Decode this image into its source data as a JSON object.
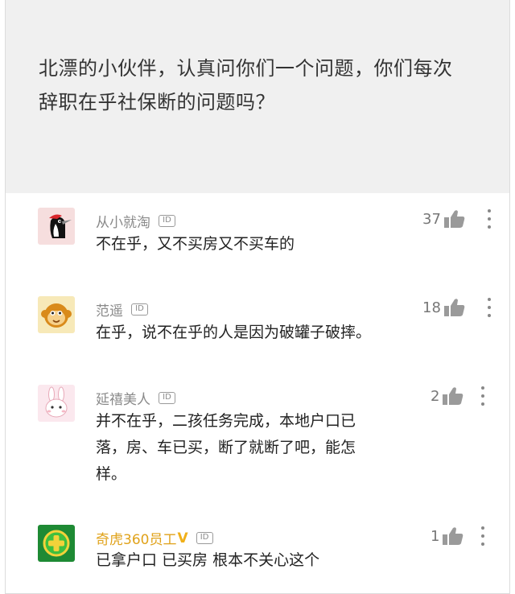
{
  "question": {
    "text_line1": "北漂的小伙伴，认真问你们一个问题，你们每次",
    "text_line2": "辞职在乎社保断的问题吗？"
  },
  "comments": [
    {
      "username": "从小就淘",
      "id_badge": "ID",
      "likes": "37",
      "avatar_icon": "woodpecker-avatar-icon",
      "lines": [
        "不在乎，又不买房又不买车的"
      ]
    },
    {
      "username": "范遥",
      "id_badge": "ID",
      "likes": "18",
      "avatar_icon": "monkey-avatar-icon",
      "lines": [
        "在乎，说不在乎的人是因为破罐子破摔。"
      ]
    },
    {
      "username": "延禧美人",
      "id_badge": "ID",
      "likes": "2",
      "avatar_icon": "rabbit-avatar-icon",
      "lines": [
        "并不在乎，二孩任务完成，本地户口已",
        "落，房、车已买，断了就断了吧，能怎",
        "样。"
      ]
    },
    {
      "username": "奇虎360员工",
      "verified": "V",
      "id_badge": "ID",
      "likes": "1",
      "avatar_icon": "360-logo-avatar-icon",
      "lines": [
        "已拿户口 已买房 根本不关心这个"
      ]
    }
  ],
  "colors": {
    "question_bg": "#f0f0f0",
    "username": "#8a8a8a",
    "verified_username": "#e0a21a",
    "like_icon": "#9a9a9a"
  },
  "icons": {
    "like": "thumbs-up-icon",
    "more": "more-vertical-icon",
    "id": "id-badge-icon"
  }
}
